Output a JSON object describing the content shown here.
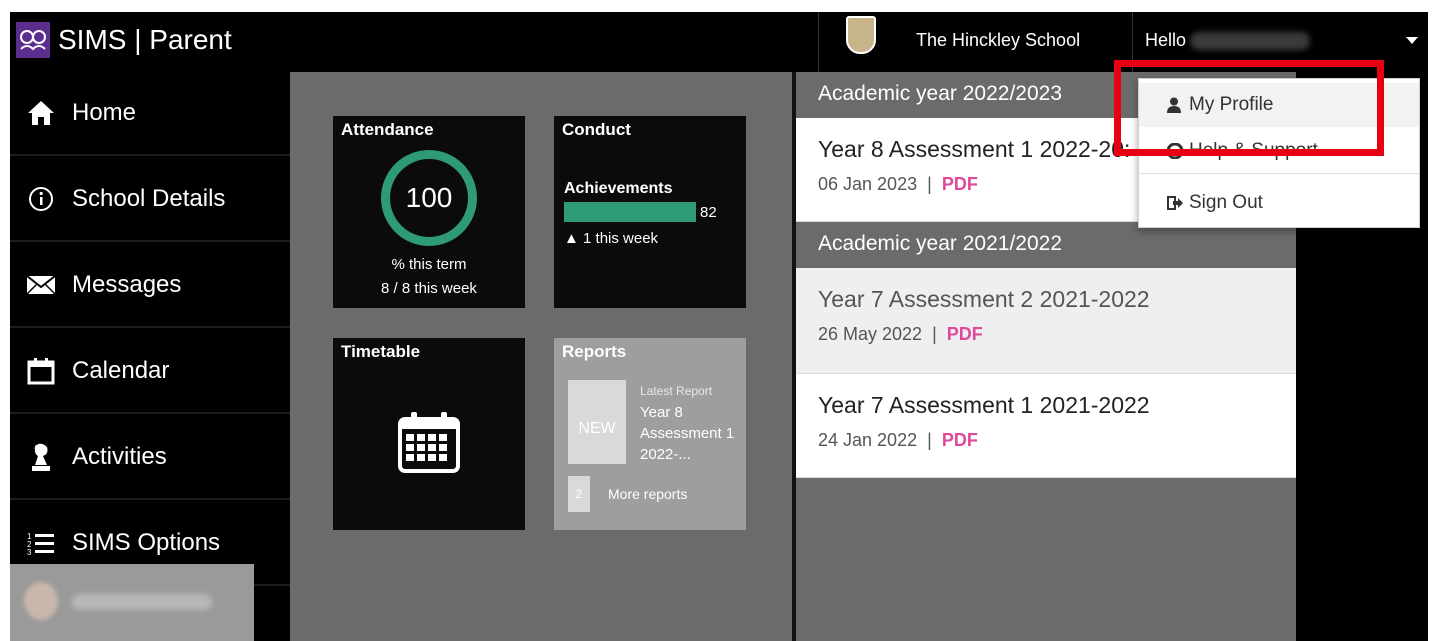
{
  "header": {
    "app_title": "SIMS | Parent",
    "school_name": "The Hinckley School",
    "greeting": "Hello"
  },
  "sidebar": {
    "items": [
      {
        "label": "Home",
        "icon": "home-icon"
      },
      {
        "label": "School Details",
        "icon": "info-icon"
      },
      {
        "label": "Messages",
        "icon": "envelope-icon"
      },
      {
        "label": "Calendar",
        "icon": "calendar-icon"
      },
      {
        "label": "Activities",
        "icon": "chess-piece-icon"
      },
      {
        "label": "SIMS Options",
        "icon": "list-icon"
      }
    ]
  },
  "tiles": {
    "attendance": {
      "title": "Attendance",
      "value": "100",
      "term_label": "% this term",
      "week_label": "8 / 8 this week"
    },
    "conduct": {
      "title": "Conduct",
      "achievements_label": "Achievements",
      "achievements_value": "82",
      "week_change": "▲ 1 this week"
    },
    "timetable": {
      "title": "Timetable"
    },
    "reports": {
      "title": "Reports",
      "new_badge": "NEW",
      "latest_label": "Latest Report",
      "latest_title": "Year 8 Assessment 1 2022-...",
      "more_count": "2",
      "more_label": "More reports"
    }
  },
  "documents": {
    "years": [
      {
        "label": "Academic year 2022/2023"
      },
      {
        "label": "Academic year 2021/2022"
      }
    ],
    "reports": [
      {
        "title": "Year 8 Assessment 1 2022-20:",
        "date": "06 Jan 2023",
        "sep": "|",
        "format": "PDF"
      },
      {
        "title": "Year 7 Assessment 2 2021-2022",
        "date": "26 May 2022",
        "sep": "|",
        "format": "PDF"
      },
      {
        "title": "Year 7 Assessment 1 2021-2022",
        "date": "24 Jan 2022",
        "sep": "|",
        "format": "PDF"
      }
    ]
  },
  "user_menu": {
    "items": [
      {
        "label": "My Profile",
        "icon": "user-icon"
      },
      {
        "label": "Help & Support",
        "icon": "help-icon"
      },
      {
        "label": "Sign Out",
        "icon": "sign-out-icon"
      }
    ]
  },
  "colors": {
    "accent_green": "#2e9a76",
    "pdf_pink": "#e0489c",
    "brand_purple": "#5b2d8e",
    "highlight_red": "#e60012"
  }
}
